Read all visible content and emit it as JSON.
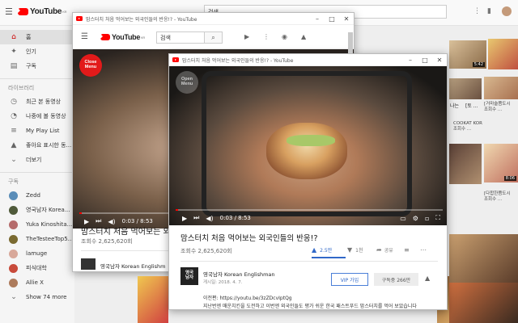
{
  "bg": {
    "logo": "YouTube",
    "logo_sup": "KR",
    "search_value": "검색",
    "sidebar": {
      "items": [
        {
          "icon": "⌂",
          "label": "홈",
          "active": true
        },
        {
          "icon": "🔥",
          "label": "인기"
        },
        {
          "icon": "▤",
          "label": "구독"
        }
      ],
      "library_heading": "라이브러리",
      "library": [
        {
          "icon": "◷",
          "label": "최근 본 동영상"
        },
        {
          "icon": "◔",
          "label": "나중에 볼 동영상"
        },
        {
          "icon": "≡",
          "label": "My Play List"
        },
        {
          "icon": "👍",
          "label": "좋아요 표시한 동..."
        },
        {
          "icon": "⌄",
          "label": "더보기"
        }
      ],
      "subs_heading": "구독",
      "subs": [
        {
          "label": "Zedd",
          "color": "#5a8db8"
        },
        {
          "label": "영국남자 Korea...",
          "color": "#4f5a3a"
        },
        {
          "label": "Yuka Kinoshita...",
          "color": "#b56b6b"
        },
        {
          "label": "TheTesteeTop5...",
          "color": "#7a6a30"
        },
        {
          "label": "lamuge",
          "color": "#d8a89a"
        },
        {
          "label": "피식대학",
          "color": "#c84a3a"
        },
        {
          "label": "Allie X",
          "color": "#ad7b5c"
        },
        {
          "label": "Show 74 more",
          "color": "#999999"
        }
      ]
    },
    "right_items": [
      {
        "text": "5:42"
      },
      {
        "text": "[거마술쯤도시\n조회수 ..."
      },
      {
        "text": "COOKAT KOR\n조회수 ..."
      },
      {
        "text": "[다합한쯤도시\n조회수 ..."
      }
    ],
    "right_extra": {
      "t1": "나는",
      "t2": "[토 ...",
      "t3": "8:06",
      "t4": "[다합한쯤도시",
      "t5": "조회수 ..."
    }
  },
  "win1": {
    "tab_title": "맘스터치 처음 먹어보는 외국인들의 반응!? - YouTube",
    "logo": "YouTube",
    "logo_sup": "KR",
    "search_value": "검색",
    "close_menu": "Close\nMenu",
    "time": "0:03 / 8:53",
    "video_title": "맘스터치 처음 먹어보는 외국",
    "views": "조회수 2,625,620회",
    "channel": "영국남자 Korean Englishm"
  },
  "win2": {
    "tab_title": "맘스터치 처음 먹어보는 외국인들의 반응!? - YouTube",
    "open_menu": "Open\nMenu",
    "time": "0:03 / 8:53",
    "video_title": "맘스터치 처음 먹어보는 외국인들의 반응!?",
    "views": "조회수 2,625,620회",
    "likes": "2.5만",
    "dislikes": "1천",
    "share": "공유",
    "channel": "영국남자 Korean Englishman",
    "date": "게시일: 2018. 4. 7.",
    "vip": "VIP 가입",
    "subscribe": "구독중 266만",
    "desc_link": "이전편: https://youtu.be/3zZDcvIptQg",
    "desc_text": "지난번엔 매운치킨을 도전하고 이번엔 외국인들도 평가 쉬운 한국 패스트푸드 맘스터치를 먹어 보았습니다",
    "avatar_text": "영국\n남자",
    "accent": "#3068c8"
  }
}
